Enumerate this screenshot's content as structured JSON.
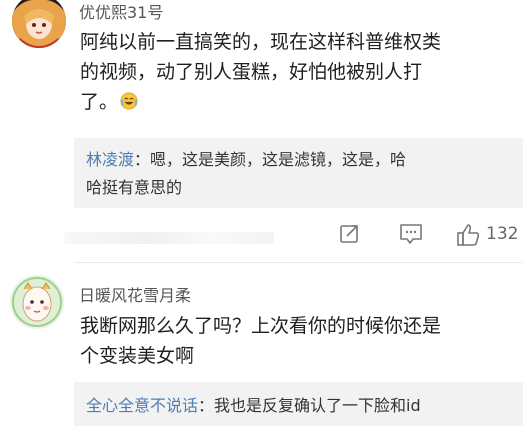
{
  "comments": [
    {
      "username": "优优熙31号",
      "text_line1": "阿纯以前一直搞笑的，现在这样科普维权类",
      "text_line2": "的视频，动了别人蛋糕，好怕他被别人打",
      "text_line3": "了。",
      "emoji": "cry-laugh-emoji",
      "reply": {
        "user": "林凌渡",
        "text_line1": "：嗯，这是美颜，这是滤镜，这是，哈",
        "text_line2": "哈挺有意思的"
      },
      "like_count": "132"
    },
    {
      "username": "日暖风花雪月柔",
      "text_line1": "我断网那么久了吗？上次看你的时候你还是",
      "text_line2": "个变装美女啊",
      "reply": {
        "user": "全心全意不说话",
        "text_line1": "：我也是反复确认了一下脸和id"
      }
    }
  ],
  "colors": {
    "reply_user": "#4f7db3",
    "reply_bg": "#f2f2f2",
    "text": "#1f1f1f",
    "username": "#555555"
  }
}
